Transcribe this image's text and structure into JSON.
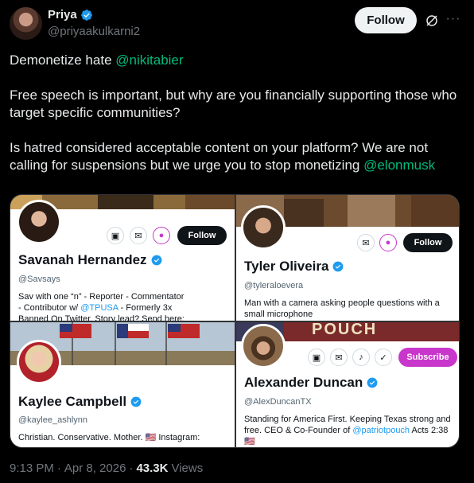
{
  "author": {
    "display_name": "Priya",
    "handle": "@priyaakulkarni2"
  },
  "header": {
    "follow_label": "Follow"
  },
  "tweet": {
    "line1_text": "Demonetize hate ",
    "line1_mention": "@nikitabier",
    "para2": "Free speech is important, but why are you financially supporting those who target specific communities?",
    "para3_text": "Is hatred considered acceptable content on your platform? We are not calling for suspensions but we urge you to stop monetizing ",
    "para3_mention": "@elonmusk"
  },
  "cards": [
    {
      "name": "Savanah Hernandez",
      "handle": "@Savsays",
      "follow_label": "Follow",
      "bio_1": "Sav with one “n” - Reporter - Commentator",
      "bio_2a": "- Contributor w/ ",
      "bio_2_link": "@TPUSA",
      "bio_2b": " - Formerly 3x",
      "bio_3": "Banned On Twitter. Story lead? Send here:"
    },
    {
      "name": "Tyler Oliveira",
      "handle": "@tyleraloevera",
      "follow_label": "Follow",
      "bio_1": "Man with a camera asking people questions with a",
      "bio_2": "small microphone"
    },
    {
      "name": "Kaylee Campbell",
      "handle": "@kaylee_ashlynn",
      "bio_1": "Christian. Conservative. Mother. 🇺🇸  Instagram:"
    },
    {
      "name": "Alexander Duncan",
      "handle": "@AlexDuncanTX",
      "subscribe_label": "Subscribe",
      "banner_text": "POUCH",
      "bio_1": "Standing for America First. Keeping Texas strong and",
      "bio_2a": "free. CEO & Co-Founder of ",
      "bio_2_link": "@patriotpouch",
      "bio_2b": " Acts 2:38",
      "bio_3": "🇺🇸"
    }
  ],
  "meta": {
    "time": "9:13 PM",
    "sep1": "·",
    "date": "Apr 8, 2026",
    "sep2": "·",
    "views_count": "43.3K",
    "views_label": "Views"
  },
  "colors": {
    "link_blue": "#1d9bf0",
    "mention_green": "#00ba7c",
    "verified_blue": "#1d9bf0",
    "subscribe_magenta": "#c936cc"
  }
}
